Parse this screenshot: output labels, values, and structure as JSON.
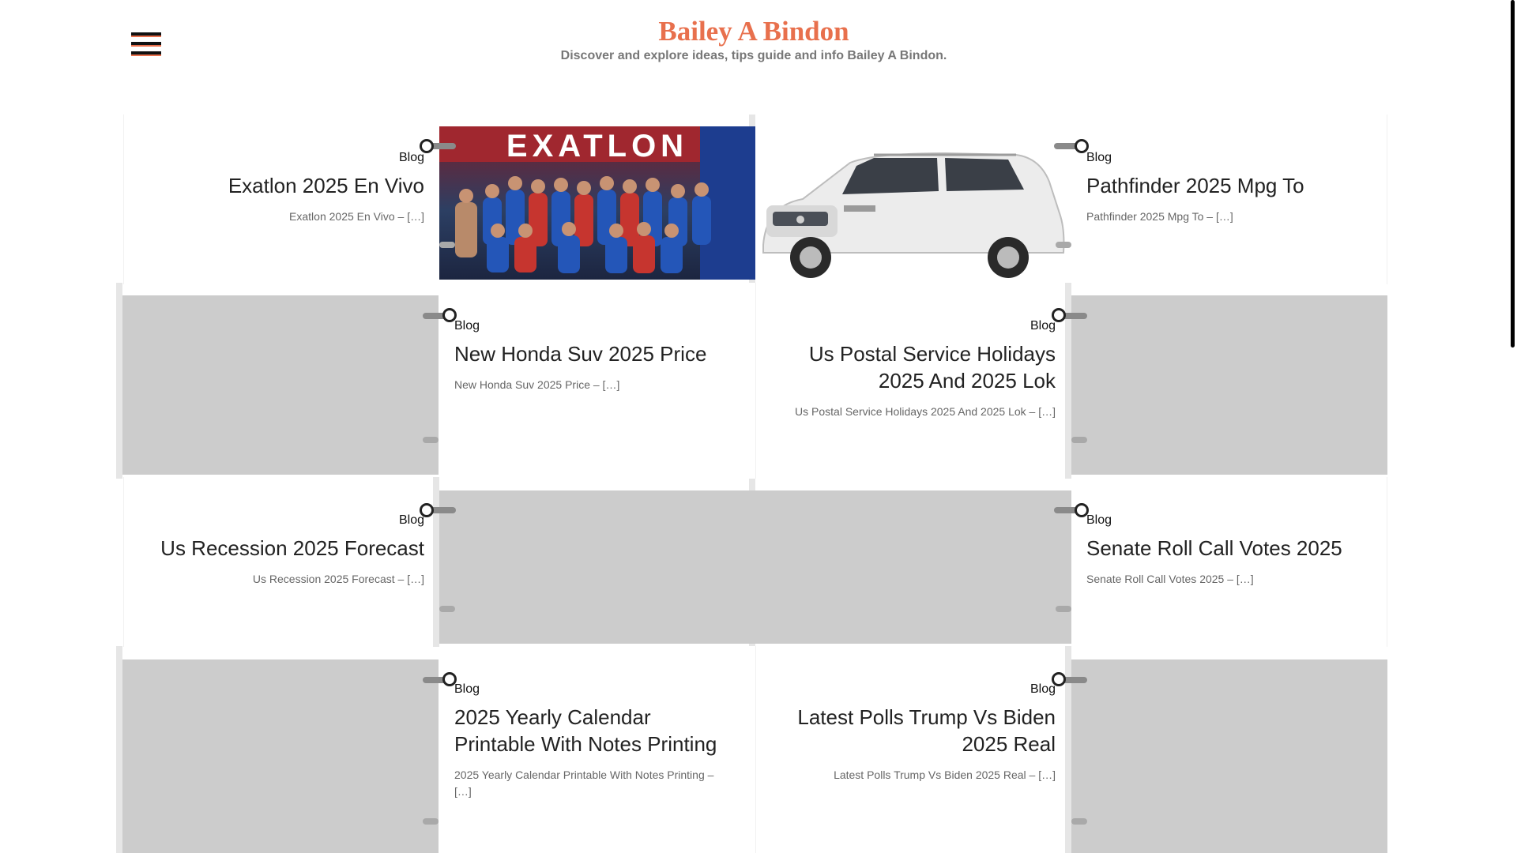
{
  "header": {
    "site_title": "Bailey A Bindon",
    "site_description": "Discover and explore ideas, tips guide and info Bailey A Bindon.",
    "menu_icon": "hamburger-menu-icon"
  },
  "colors": {
    "brand": "#e8704d",
    "placeholder": "#cccccc",
    "text": "#222222",
    "muted": "#666666"
  },
  "posts": [
    {
      "category": "Blog",
      "title": "Exatlon 2025 En Vivo",
      "excerpt": "Exatlon 2025 En Vivo – […]",
      "image": "Exatlon cast group photo"
    },
    {
      "category": "Blog",
      "title": "Pathfinder 2025 Mpg To",
      "excerpt": "Pathfinder 2025 Mpg To – […]",
      "image": "White SUV"
    },
    {
      "category": "Blog",
      "title": "New Honda Suv 2025 Price",
      "excerpt": "New Honda Suv 2025 Price – […]"
    },
    {
      "category": "Blog",
      "title": "Us Postal Service Holidays 2025 And 2025 Lok",
      "excerpt": "Us Postal Service Holidays 2025 And 2025 Lok – […]"
    },
    {
      "category": "Blog",
      "title": "Us Recession 2025 Forecast",
      "excerpt": "Us Recession 2025 Forecast – […]"
    },
    {
      "category": "Blog",
      "title": "Senate Roll Call Votes 2025",
      "excerpt": "Senate Roll Call Votes 2025 – […]"
    },
    {
      "category": "Blog",
      "title": "2025 Yearly Calendar Printable With Notes Printing",
      "excerpt": "2025 Yearly Calendar Printable With Notes Printing – […]"
    },
    {
      "category": "Blog",
      "title": "Latest Polls Trump Vs Biden 2025 Real",
      "excerpt": "Latest Polls Trump Vs Biden 2025 Real – […]"
    }
  ]
}
